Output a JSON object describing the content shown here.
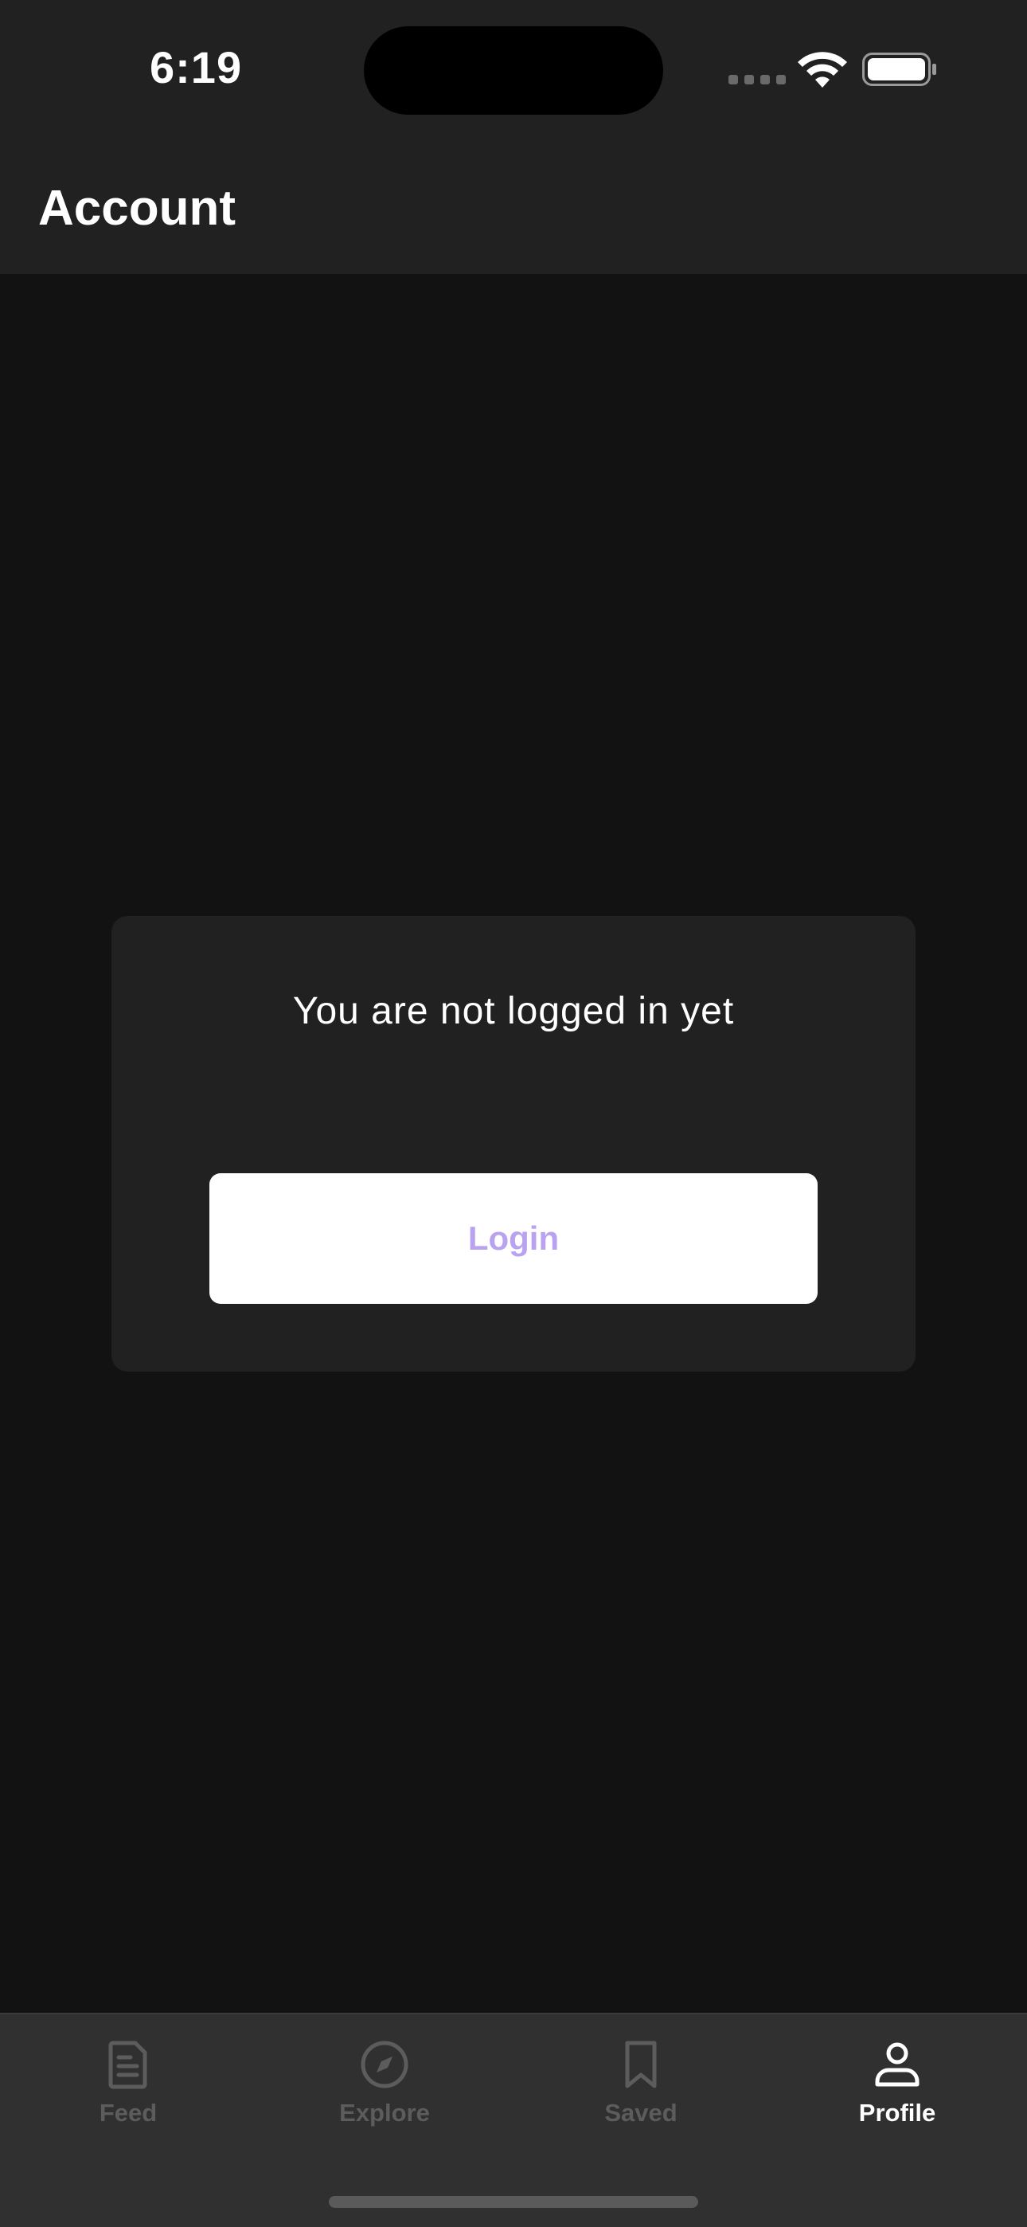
{
  "status_bar": {
    "time": "6:19"
  },
  "header": {
    "title": "Account"
  },
  "card": {
    "message": "You are not logged in yet",
    "login_label": "Login",
    "login_color": "#b9a3f0"
  },
  "tab_bar": {
    "items": [
      {
        "label": "Feed",
        "icon": "document-icon",
        "active": false
      },
      {
        "label": "Explore",
        "icon": "compass-icon",
        "active": false
      },
      {
        "label": "Saved",
        "icon": "bookmark-icon",
        "active": false
      },
      {
        "label": "Profile",
        "icon": "person-icon",
        "active": true
      }
    ]
  }
}
